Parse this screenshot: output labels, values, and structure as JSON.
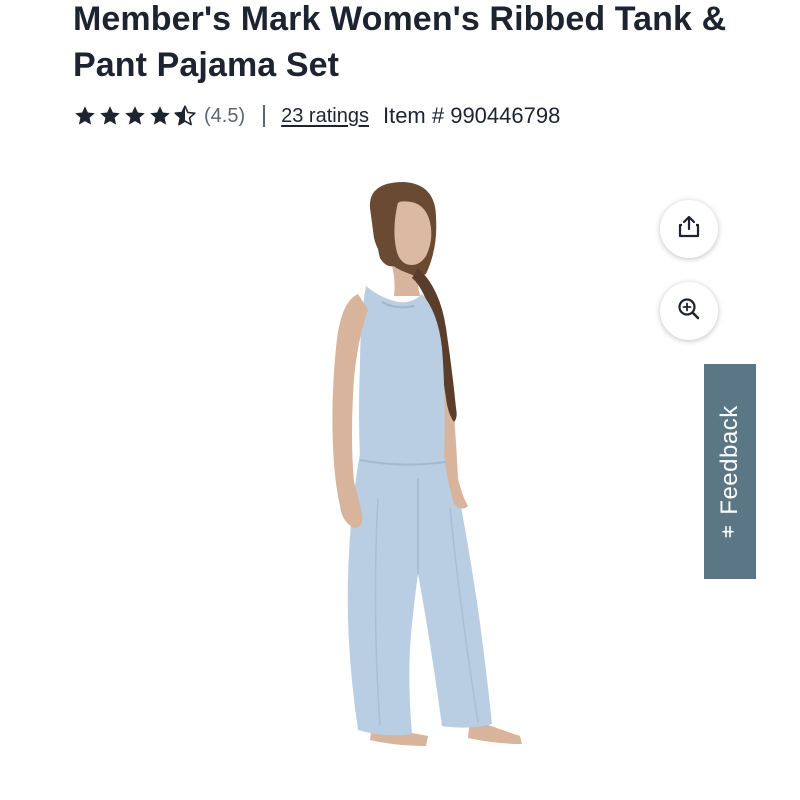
{
  "product": {
    "title": "Member's Mark Women's Ribbed Tank & Pant Pajama Set",
    "rating_value": "(4.5)",
    "stars": 4.5,
    "ratings_link": "23 ratings",
    "item_number": "Item # 990446798"
  },
  "actions": {
    "share_icon": "share-icon",
    "zoom_icon": "zoom-in-icon"
  },
  "feedback": {
    "label": "Feedback",
    "icon": "feedback-icon"
  },
  "colors": {
    "text": "#1d2430",
    "muted": "#5e6670",
    "feedback_bg": "#5b7684",
    "garment": "#b9cee2"
  }
}
